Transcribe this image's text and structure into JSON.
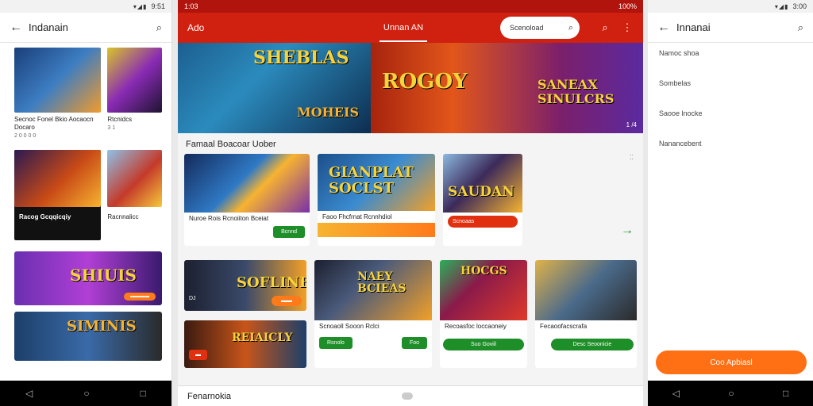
{
  "left": {
    "status_time": "9:51",
    "title": "Indanain",
    "cards": [
      {
        "caption": "Secnoc Fonel Bkio Aocaocn Docaro",
        "sub": "2 0 0 0 0"
      },
      {
        "caption": "Rtcnidcs",
        "sub": "3 1"
      },
      {
        "caption": "Racog Gcqqicqiy",
        "sub": ""
      },
      {
        "caption": "Racnnalicc",
        "sub": ""
      }
    ],
    "banner_pill": ""
  },
  "center": {
    "status_left": "1:03",
    "status_right": "100%",
    "app_title": "Ado",
    "tab_label": "Unnan AN",
    "search_placeholder": "Scenoload",
    "hero": {
      "left_text1": "SHEBLAS",
      "left_text2": "MOHEIS",
      "right_text1": "ROGOY",
      "right_text2": "SANEAX SINULCRS",
      "page": "1 /4"
    },
    "section_title": "Famaal Boacoar Uober",
    "row1": [
      {
        "caption": "Nuroe Rois Rcnoiiton Bceiat",
        "btn": "Bcnnd",
        "rating": ""
      },
      {
        "caption": "Faoo Fhcfrnat Rcnnhdiol",
        "banner": "GIANPLAT SOCLST",
        "btn": ""
      },
      {
        "caption": "Scnoaas",
        "banner": "SAUDAN",
        "btn": ""
      }
    ],
    "row2": [
      {
        "caption": "",
        "banner": "SOFLINE",
        "tag": "DJ",
        "btn": ""
      },
      {
        "caption": "",
        "banner": "REIAICLY",
        "btn": ""
      },
      {
        "caption": "Scnoaoll Sooon Rclci",
        "banner": "NAEY BCIEAS",
        "btn1": "Rsnolo",
        "btn2": "Foo"
      },
      {
        "caption": "Recoasfoc loccaoneiy",
        "banner": "HOCGS",
        "btn": "Suo Goviil"
      },
      {
        "caption": "Fecaoofacscrafa",
        "banner": "",
        "btn": "Desc Seoonicie"
      }
    ],
    "bottom_label": "Fenarnokia"
  },
  "right": {
    "status_time": "3:00",
    "title": "Innanai",
    "items": [
      "Namoc shoa",
      "Sombelas",
      "Saooe lnocke",
      "Nanancebent"
    ],
    "cta": "Coo Apbiasl"
  },
  "colors": {
    "accent_red": "#d0200f",
    "accent_orange": "#ff6f14",
    "accent_green": "#1e8e28"
  }
}
